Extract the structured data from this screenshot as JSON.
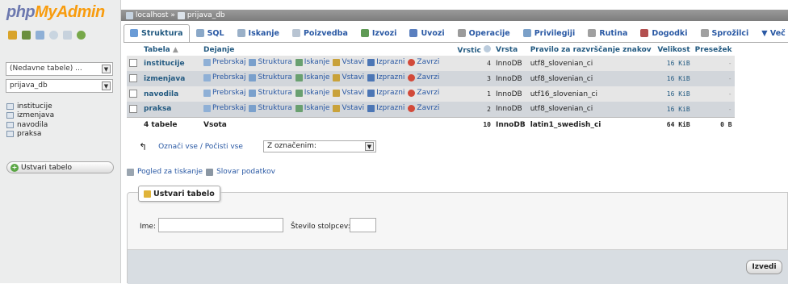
{
  "app": {
    "logo_a": "php",
    "logo_b": "MyAdmin"
  },
  "sidebar": {
    "recent_label": "(Nedavne tabele) ...",
    "db_select": "prijava_db",
    "tables": [
      "institucije",
      "izmenjava",
      "navodila",
      "praksa"
    ],
    "new_table": "Ustvari tabelo"
  },
  "breadcrumb": {
    "server": "localhost",
    "sep": "»",
    "db": "prijava_db"
  },
  "tabs": [
    {
      "label": "Struktura",
      "icon": "structure-icon",
      "color": "#6a9bd6"
    },
    {
      "label": "SQL",
      "icon": "sql-icon",
      "color": "#8aa8c8"
    },
    {
      "label": "Iskanje",
      "icon": "search-icon",
      "color": "#9ab0c8"
    },
    {
      "label": "Poizvedba",
      "icon": "query-icon",
      "color": "#b8c4d2"
    },
    {
      "label": "Izvozi",
      "icon": "export-icon",
      "color": "#5f9a55"
    },
    {
      "label": "Uvozi",
      "icon": "import-icon",
      "color": "#5a7fbf"
    },
    {
      "label": "Operacije",
      "icon": "wrench-icon",
      "color": "#9b9b9b"
    },
    {
      "label": "Privilegiji",
      "icon": "privileges-icon",
      "color": "#7ba0c8"
    },
    {
      "label": "Rutina",
      "icon": "routine-icon",
      "color": "#a0a0a0"
    },
    {
      "label": "Dogodki",
      "icon": "clock-icon",
      "color": "#b35050"
    },
    {
      "label": "Sprožilci",
      "icon": "trigger-icon",
      "color": "#a0a0a0"
    },
    {
      "label": "▼ Več",
      "icon": "more-icon",
      "color": "#ffffff"
    }
  ],
  "grid": {
    "headers": {
      "table": "Tabela",
      "sort": "▲",
      "action": "Dejanje",
      "rows": "Vrstic",
      "type": "Vrsta",
      "collation": "Pravilo za razvrščanje znakov",
      "size": "Velikost",
      "overhead": "Presežek"
    },
    "actions": [
      "Prebrskaj",
      "Struktura",
      "Iskanje",
      "Vstavi",
      "Izprazni",
      "Zavrzi"
    ],
    "rows": [
      {
        "name": "institucije",
        "rows": "4",
        "type": "InnoDB",
        "collation": "utf8_slovenian_ci",
        "size": "16 KiB",
        "overhead": "-"
      },
      {
        "name": "izmenjava",
        "rows": "3",
        "type": "InnoDB",
        "collation": "utf8_slovenian_ci",
        "size": "16 KiB",
        "overhead": "-"
      },
      {
        "name": "navodila",
        "rows": "1",
        "type": "InnoDB",
        "collation": "utf16_slovenian_ci",
        "size": "16 KiB",
        "overhead": "-"
      },
      {
        "name": "praksa",
        "rows": "2",
        "type": "InnoDB",
        "collation": "utf8_slovenian_ci",
        "size": "16 KiB",
        "overhead": "-"
      }
    ],
    "summary": {
      "name": "4 tabele",
      "action": "Vsota",
      "rows": "10",
      "type": "InnoDB",
      "collation": "latin1_swedish_ci",
      "size": "64 KiB",
      "overhead": "0 B"
    }
  },
  "bulk": {
    "check_all": "Označi vse / Počisti vse",
    "with_selected": "Z označenim:"
  },
  "links": {
    "print_view": "Pogled za tiskanje",
    "data_dict": "Slovar podatkov"
  },
  "create": {
    "legend": "Ustvari tabelo",
    "name_label": "Ime:",
    "cols_label": "Število stolpcev:",
    "go": "Izvedi"
  },
  "colors": {
    "link": "#2a59a4",
    "row_odd": "#e6e6e6",
    "row_even": "#d2d6db",
    "logo_php": "#6c78af",
    "logo_my": "#f89c0e"
  }
}
